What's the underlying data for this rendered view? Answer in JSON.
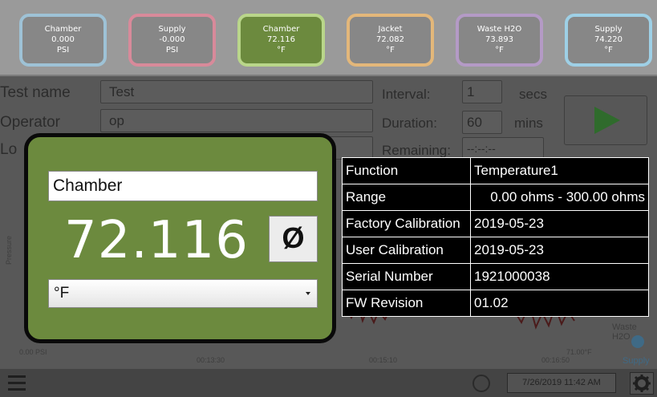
{
  "sensors": [
    {
      "name": "Chamber",
      "value": "0.000",
      "unit": "PSI",
      "border": "#9ec2d6",
      "bg": "#878787"
    },
    {
      "name": "Supply",
      "value": "-0.000",
      "unit": "PSI",
      "border": "#d88a9a",
      "bg": "#878787"
    },
    {
      "name": "Chamber",
      "value": "72.116",
      "unit": "°F",
      "border": "#b9d68a",
      "bg": "#6c8a3e"
    },
    {
      "name": "Jacket",
      "value": "72.082",
      "unit": "°F",
      "border": "#e3b77a",
      "bg": "#878787"
    },
    {
      "name": "Waste H2O",
      "value": "73.893",
      "unit": "°F",
      "border": "#b49ac6",
      "bg": "#878787"
    },
    {
      "name": "Supply",
      "value": "74.220",
      "unit": "°F",
      "border": "#9ed0e6",
      "bg": "#878787"
    }
  ],
  "form": {
    "test_name_label": "Test name",
    "test_name_value": "Test",
    "operator_label": "Operator",
    "operator_value": "op",
    "location_label": "Lo",
    "interval_label": "Interval:",
    "interval_value": "1",
    "interval_unit": "secs",
    "duration_label": "Duration:",
    "duration_value": "60",
    "duration_unit": "mins",
    "remaining_label": "Remaining:",
    "remaining_value": "--:--:--"
  },
  "chart_bg": {
    "y_axis_label": "Pressure",
    "left_bottom_label": "0.00 PSI",
    "right_bottom_label": "71.00°F",
    "x_ticks": [
      "00:13:30",
      "00:15:10",
      "00:16:50"
    ],
    "legend": [
      "Waste H2O",
      "Supply"
    ]
  },
  "popup": {
    "name": "Chamber",
    "value": "72.116",
    "zero_label": "Ø",
    "unit": "°F",
    "colors": {
      "card_bg": "#6c8a3e",
      "card_border": "#0a0a0a"
    }
  },
  "info_table": [
    {
      "key": "Function",
      "value": "Temperature1"
    },
    {
      "key": "Range",
      "value": "0.00 ohms - 300.00 ohms"
    },
    {
      "key": "Factory Calibration",
      "value": "2019-05-23"
    },
    {
      "key": "User Calibration",
      "value": "2019-05-23"
    },
    {
      "key": "Serial Number",
      "value": "1921000038"
    },
    {
      "key": "FW Revision",
      "value": "01.02"
    }
  ],
  "bottom": {
    "datetime": "7/26/2019 11:42 AM",
    "menu_icon": "hamburger-icon",
    "settings_icon": "gear-icon"
  }
}
